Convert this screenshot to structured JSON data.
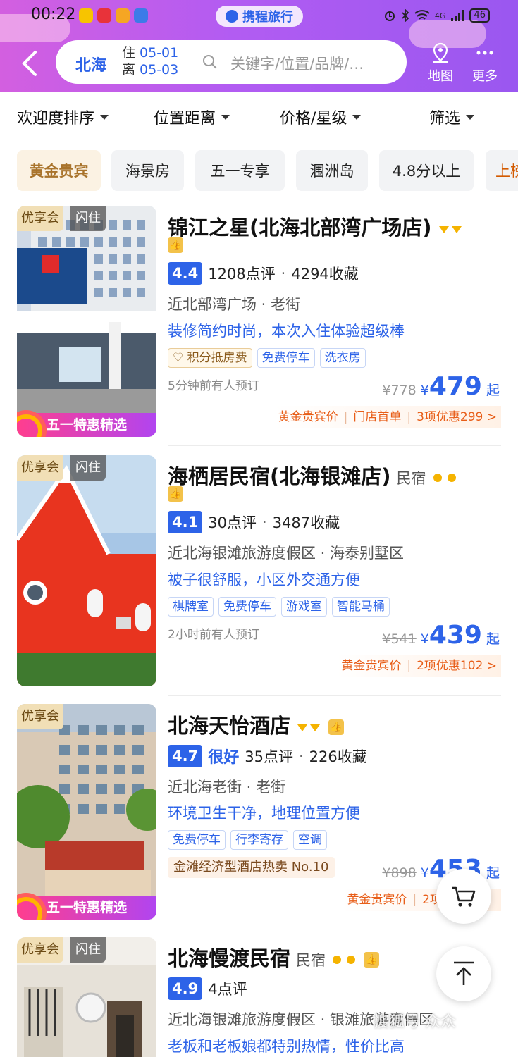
{
  "status_bar": {
    "time": "00:22",
    "network": "4G",
    "battery": "46"
  },
  "app": {
    "brand": "携程旅行"
  },
  "search": {
    "city": "北海",
    "checkin_label": "住",
    "checkin": "05-01",
    "checkout_label": "离",
    "checkout": "05-03",
    "placeholder": "关键字/位置/品牌/…"
  },
  "header_actions": {
    "map": "地图",
    "more": "更多"
  },
  "sort_bar": [
    "欢迎度排序",
    "位置距离",
    "价格/星级",
    "筛选"
  ],
  "quick_filters": [
    "黄金贵宾",
    "海景房",
    "五一专享",
    "涠洲岛",
    "4.8分以上",
    "上榜"
  ],
  "hotels": [
    {
      "tags": [
        "优享会",
        "闪住"
      ],
      "promo": "五一特惠精选",
      "name": "锦江之星(北海北部湾广场店)",
      "type": "",
      "rating": "4.4",
      "rating_word": "",
      "reviews": "1208点评",
      "favorites": "4294收藏",
      "location": "近北部湾广场 · 老街",
      "review_quote": "装修简约时尚，本次入住体验超级棒",
      "facilities": [
        "积分抵房费",
        "免费停车",
        "洗衣房"
      ],
      "booked": "5分钟前有人预订",
      "rank": "",
      "orig_price": "¥778",
      "price": "479",
      "deals": [
        "黄金贵宾价",
        "门店首单",
        "3项优惠299 >"
      ]
    },
    {
      "tags": [
        "优享会",
        "闪住"
      ],
      "promo": "",
      "name": "海栖居民宿(北海银滩店)",
      "type": "民宿",
      "rating": "4.1",
      "rating_word": "",
      "reviews": "30点评",
      "favorites": "3487收藏",
      "location": "近北海银滩旅游度假区 · 海泰别墅区",
      "review_quote": "被子很舒服，小区外交通方便",
      "facilities": [
        "棋牌室",
        "免费停车",
        "游戏室",
        "智能马桶"
      ],
      "booked": "2小时前有人预订",
      "rank": "",
      "orig_price": "¥541",
      "price": "439",
      "deals": [
        "黄金贵宾价",
        "2项优惠102 >"
      ]
    },
    {
      "tags": [
        "优享会"
      ],
      "promo": "五一特惠精选",
      "name": "北海天怡酒店",
      "type": "",
      "rating": "4.7",
      "rating_word": "很好",
      "reviews": "35点评",
      "favorites": "226收藏",
      "location": "近北海老街 · 老街",
      "review_quote": "环境卫生干净，地理位置方便",
      "facilities": [
        "免费停车",
        "行李寄存",
        "空调"
      ],
      "booked": "",
      "rank": "金滩经济型酒店热卖 No.10",
      "orig_price": "¥898",
      "price": "453",
      "deals": [
        "黄金贵宾价",
        "2项优惠"
      ]
    },
    {
      "tags": [
        "优享会",
        "闪住"
      ],
      "promo": "",
      "name": "北海慢渡民宿",
      "type": "民宿",
      "rating": "4.9",
      "rating_word": "",
      "reviews": "4点评",
      "favorites": "",
      "location": "近北海银滩旅游度假区 · 银滩旅游度假区",
      "review_quote": "老板和老板娘都特别热情，性价比高",
      "facilities": [],
      "booked": "",
      "rank": "",
      "orig_price": "",
      "price": "",
      "deals": []
    }
  ],
  "price_suffix": "起",
  "currency": "¥",
  "colors": {
    "brand_blue": "#2d63e8",
    "header_purple": "#b25cf2",
    "deal_orange": "#e85d17"
  },
  "floating": {
    "cart": "cart-icon",
    "top": "back-to-top-icon"
  },
  "watermark": "搜狐号·众众"
}
